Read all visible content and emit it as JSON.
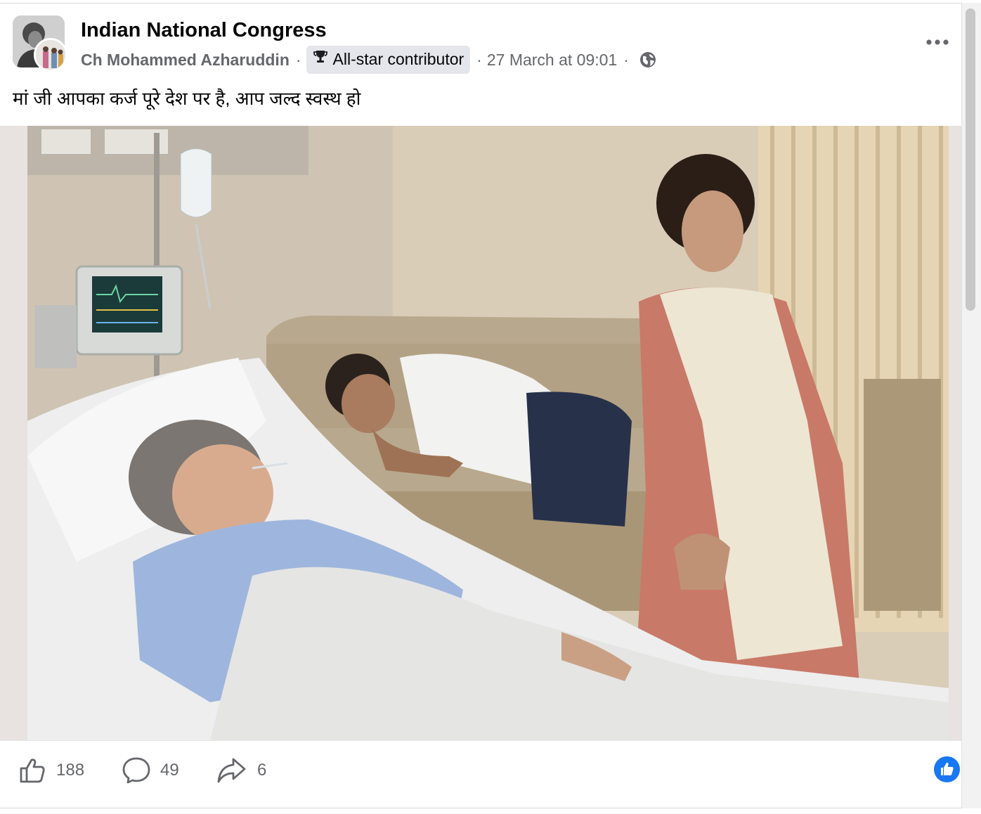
{
  "post": {
    "group_name": "Indian National Congress",
    "author": "Ch Mohammed Azharuddin",
    "badge_label": "All-star contributor",
    "badge_icon": "trophy-icon",
    "timestamp": "27 March at 09:01",
    "privacy_icon": "globe-icon",
    "separator": "·",
    "text": "मां जी आपका कर्ज पूरे देश पर है, आप जल्द स्वस्थ हो"
  },
  "actions": {
    "likes": "188",
    "comments": "49",
    "shares": "6"
  },
  "colors": {
    "meta_gray": "#65676b",
    "badge_bg": "#e4e6eb",
    "like_blue": "#1877f2"
  }
}
